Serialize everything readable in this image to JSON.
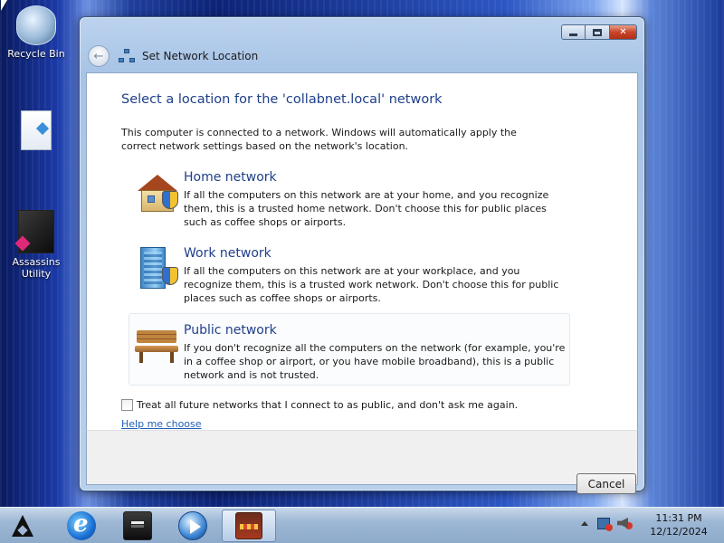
{
  "desktop": {
    "icons": [
      {
        "label": "Recycle Bin",
        "icon": "recycle-bin-icon"
      },
      {
        "label": "",
        "icon": "document-icon"
      },
      {
        "label": "Assassins Utility",
        "icon": "assassins-utility-icon"
      }
    ]
  },
  "window": {
    "title": "Set Network Location",
    "heading": "Select a location for the 'collabnet.local' network",
    "description": "This computer is connected to a network. Windows will automatically apply the correct network settings based on the network's location.",
    "options": [
      {
        "title": "Home network",
        "text": "If all the computers on this network are at your home, and you recognize them, this is a trusted home network.  Don't choose this for public places such as coffee shops or airports.",
        "icon": "home-network-icon"
      },
      {
        "title": "Work network",
        "text": "If all the computers on this network are at your workplace, and you recognize them, this is a trusted work network.  Don't choose this for public places such as coffee shops or airports.",
        "icon": "work-network-icon"
      },
      {
        "title": "Public network",
        "text": "If you don't recognize all the computers on the network (for example, you're in a coffee shop or airport, or you have mobile broadband), this is a public network and is not trusted.",
        "icon": "public-network-icon"
      }
    ],
    "checkbox_label": "Treat all future networks that I connect to as public, and don't ask me again.",
    "checkbox_checked": false,
    "help_link": "Help me choose",
    "cancel_label": "Cancel"
  },
  "taskbar": {
    "pinned": [
      "start-icon",
      "internet-explorer-icon",
      "drive-icon",
      "media-player-icon",
      "network-location-task-icon"
    ],
    "clock": {
      "time": "11:31 PM",
      "date": "12/12/2024"
    }
  }
}
